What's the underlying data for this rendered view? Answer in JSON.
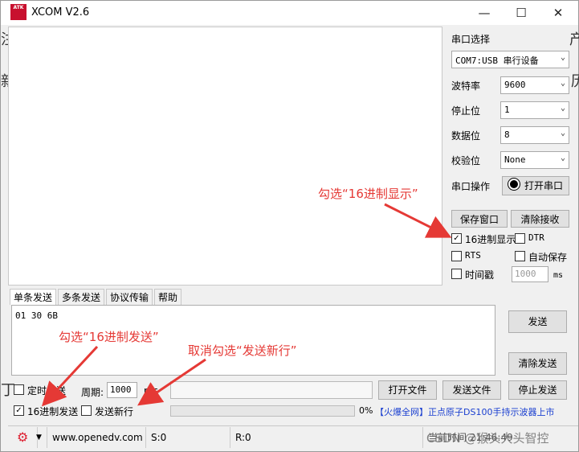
{
  "title": "XCOM V2.6",
  "logo_text": "ATK",
  "window_controls": {
    "minimize": "—",
    "maximize": "☐",
    "close": "✕"
  },
  "background_chars": [
    "注",
    "新",
    "丁",
    "产",
    "历"
  ],
  "panel": {
    "port_select_label": "串口选择",
    "port_value": "COM7:USB 串行设备",
    "baud_label": "波特率",
    "baud_value": "9600",
    "stop_label": "停止位",
    "stop_value": "1",
    "data_label": "数据位",
    "data_value": "8",
    "parity_label": "校验位",
    "parity_value": "None",
    "op_label": "串口操作",
    "open_port": "打开串口",
    "save_window": "保存窗口",
    "clear_recv": "清除接收",
    "hex_display": "16进制显示",
    "dtr": "DTR",
    "rts": "RTS",
    "autosave": "自动保存",
    "timestamp": "时间戳",
    "timestamp_value": "1000",
    "ms": "ms"
  },
  "annotations": {
    "a1": "勾选“16进制显示”",
    "a2": "勾选“16进制发送”",
    "a3": "取消勾选“发送新行”"
  },
  "tabs": [
    "单条发送",
    "多条发送",
    "协议传输",
    "帮助"
  ],
  "send_text": "01 30 6B",
  "send_btn": "发送",
  "clear_send": "清除发送",
  "timed_send": "定时发送",
  "period_label": "周期:",
  "period_value": "1000",
  "ms": "ms",
  "open_file": "打开文件",
  "send_file": "发送文件",
  "stop_send": "停止发送",
  "hex_send": "16进制发送",
  "send_newline": "发送新行",
  "progress": "0%",
  "ad": "【火爆全网】正点原子DS100手持示波器上市",
  "status": {
    "url": "www.openedv.com",
    "s": "S:0",
    "r": "R:0",
    "time": "当前时间 21:46:49",
    "watermark": "CSDN @猴头大头智控"
  }
}
